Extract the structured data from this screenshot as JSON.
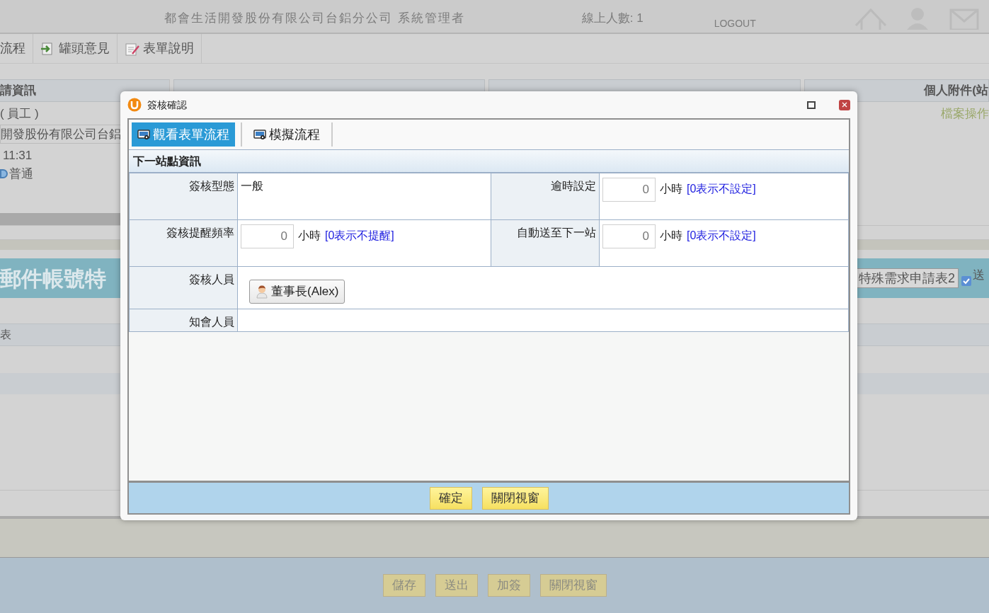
{
  "header": {
    "company": "都會生活開發股份有限公司台鋁分公司 系統管理者",
    "online": "線上人數: 1",
    "logout": "LOGOUT"
  },
  "toolbar": [
    {
      "label": "流程"
    },
    {
      "label": "罐頭意見"
    },
    {
      "label": "表單說明"
    }
  ],
  "applicant": {
    "title": "請資訊",
    "role": "( 員工 )",
    "company": "開發股份有限公司台鋁",
    "time": "11:31",
    "priority": {
      "label": "普通",
      "selected": true
    }
  },
  "attachments": {
    "title": "個人附件(站",
    "action": "檔案操作"
  },
  "banner": {
    "title": "郵件帳號特",
    "form_button": "特殊需求申請表2",
    "send": {
      "label": "送",
      "checked": true
    }
  },
  "section_label": "表",
  "footer_buttons": [
    "儲存",
    "送出",
    "加簽",
    "關閉視窗"
  ],
  "dialog": {
    "title": "簽核確認",
    "tabs": [
      {
        "label": "觀看表單流程",
        "selected": true
      },
      {
        "label": "模擬流程",
        "selected": false
      }
    ],
    "section": "下一站點資訊",
    "rows": [
      [
        {
          "label": "簽核型態",
          "kind": "text",
          "value": "一般"
        },
        {
          "label": "逾時設定",
          "kind": "hours",
          "value": "0",
          "unit": "小時",
          "hint": "[0表示不設定]"
        }
      ],
      [
        {
          "label": "簽核提醒頻率",
          "kind": "hours",
          "value": "0",
          "unit": "小時",
          "hint": "[0表示不提醒]"
        },
        {
          "label": "自動送至下一站",
          "kind": "hours",
          "value": "0",
          "unit": "小時",
          "hint": "[0表示不設定]"
        }
      ],
      [
        {
          "label": "簽核人員",
          "kind": "people",
          "people": [
            "董事長(Alex)"
          ]
        }
      ],
      [
        {
          "label": "知會人員",
          "kind": "people"
        }
      ]
    ],
    "buttons": [
      "確定",
      "關閉視窗"
    ]
  }
}
